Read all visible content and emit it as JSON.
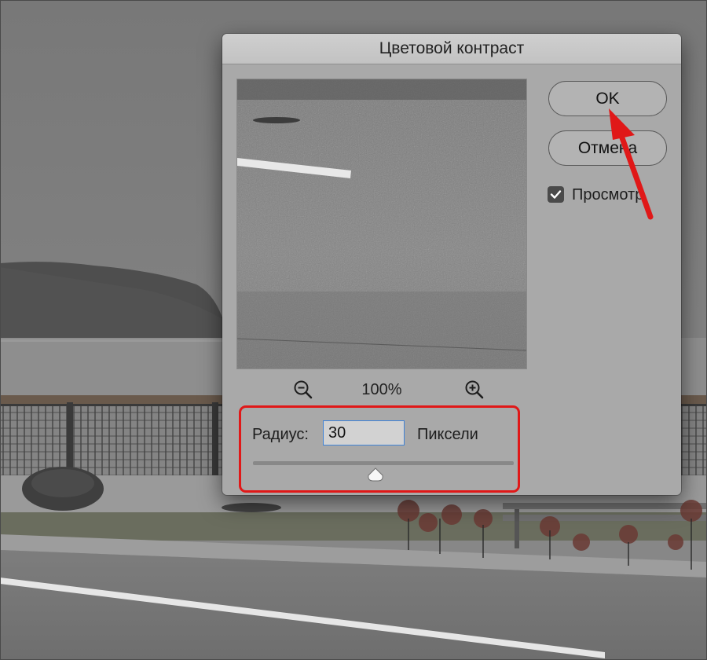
{
  "dialog": {
    "title": "Цветовой контраст",
    "ok_label": "OK",
    "cancel_label": "Отмена",
    "preview_checkbox": {
      "label": "Просмотр",
      "checked": true
    },
    "zoom": {
      "level": "100%",
      "zoom_out_icon": "zoom-out-icon",
      "zoom_in_icon": "zoom-in-icon"
    },
    "radius": {
      "label": "Радиус:",
      "value": "30",
      "unit": "Пиксели",
      "slider_fraction": 0.47
    }
  },
  "annotations": {
    "highlight_color": "#e01818",
    "arrow_color": "#e01818"
  }
}
